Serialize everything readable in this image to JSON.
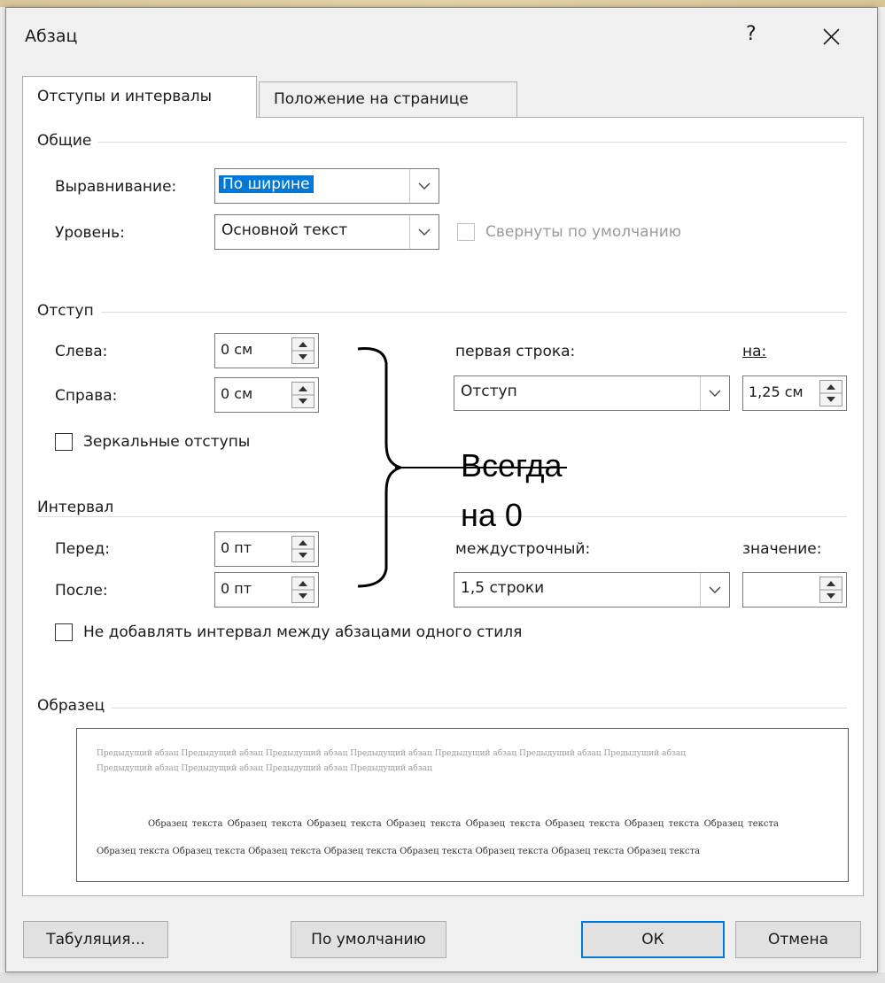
{
  "dialog": {
    "title": "Абзац",
    "help": "?",
    "close_icon": "close-icon"
  },
  "tabs": [
    {
      "label": "Отступы и интервалы",
      "active": true
    },
    {
      "label": "Положение на странице",
      "active": false
    }
  ],
  "general": {
    "group": "Общие",
    "alignment_label": "Выравнивание:",
    "alignment_value": "По ширине",
    "level_label": "Уровень:",
    "level_value": "Основной текст",
    "collapsed_label": "Свернуты по умолчанию"
  },
  "indent": {
    "group": "Отступ",
    "left_label": "Слева:",
    "left_value": "0 см",
    "right_label": "Справа:",
    "right_value": "0 см",
    "first_line_label": "первая строка:",
    "first_line_value": "Отступ",
    "by_label": "на:",
    "by_value": "1,25 см",
    "mirror_label": "Зеркальные отступы"
  },
  "spacing": {
    "group": "Интервал",
    "before_label": "Перед:",
    "before_value": "0 пт",
    "after_label": "После:",
    "after_value": "0 пт",
    "line_label": "междустрочный:",
    "line_value": "1,5 строки",
    "at_label": "значение:",
    "at_value": "",
    "no_space_label": "Не добавлять интервал между абзацами одного стиля"
  },
  "preview": {
    "group": "Образец",
    "previous_text": "Предыдущий абзац Предыдущий абзац Предыдущий абзац Предыдущий абзац Предыдущий абзац Предыдущий абзац Предыдущий абзац Предыдущий абзац Предыдущий абзац Предыдущий абзац Предыдущий абзац",
    "sample_text": "Образец текста Образец текста Образец текста Образец текста Образец текста Образец текста Образец текста Образец текста Образец текста Образец текста Образец текста Образец текста Образец текста Образец текста Образец текста Образец текста"
  },
  "buttons": {
    "tabs": "Табуляция...",
    "default": "По умолчанию",
    "ok": "ОК",
    "cancel": "Отмена"
  },
  "annotation": {
    "line1": "Всегда",
    "line2": "на 0"
  },
  "colors": {
    "selection": "#0078d7",
    "dialog_bg": "#f0f0f0"
  }
}
